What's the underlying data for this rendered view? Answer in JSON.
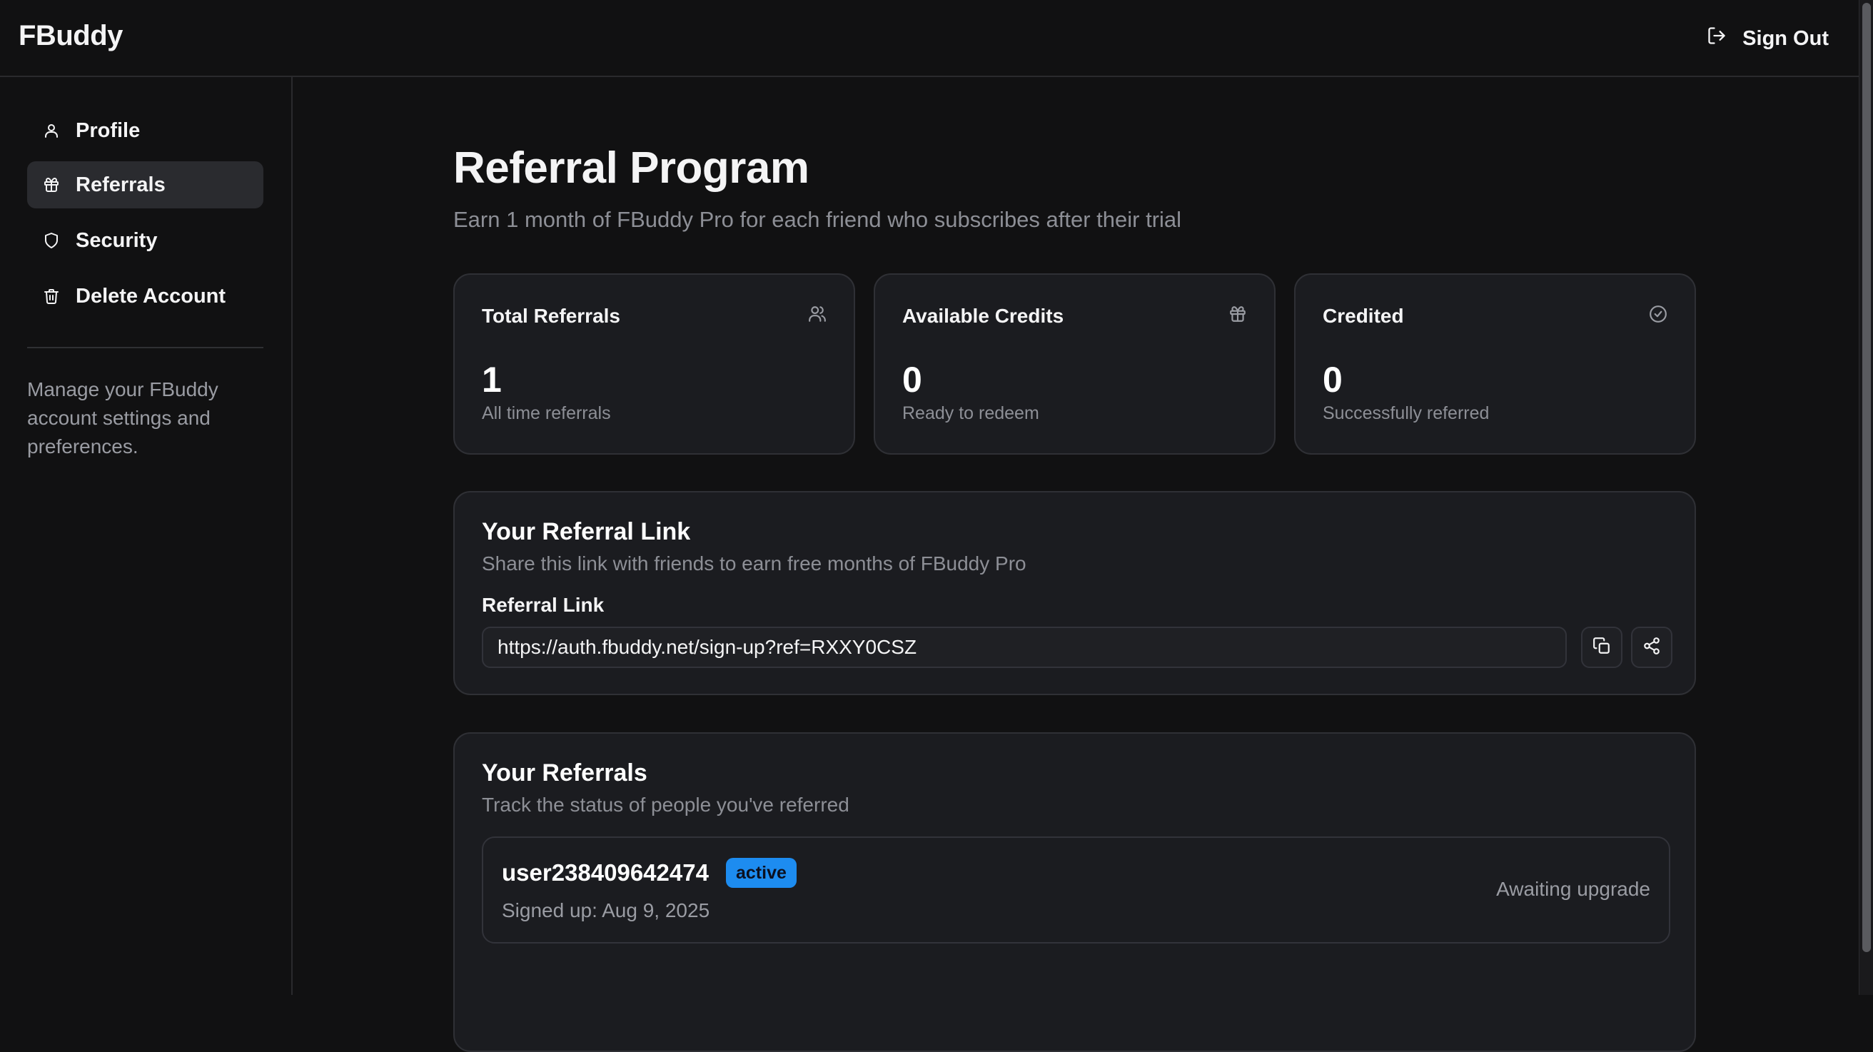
{
  "app": {
    "name": "FBuddy"
  },
  "header": {
    "sign_out_label": "Sign Out"
  },
  "sidebar": {
    "items": [
      {
        "label": "Profile",
        "icon": "user-icon",
        "active": false
      },
      {
        "label": "Referrals",
        "icon": "gift-icon",
        "active": true
      },
      {
        "label": "Security",
        "icon": "shield-icon",
        "active": false
      },
      {
        "label": "Delete Account",
        "icon": "trash-icon",
        "active": false
      }
    ],
    "note": "Manage your FBuddy account settings and preferences."
  },
  "page": {
    "title": "Referral Program",
    "subtitle": "Earn 1 month of FBuddy Pro for each friend who subscribes after their trial"
  },
  "stats": [
    {
      "label": "Total Referrals",
      "value": "1",
      "hint": "All time referrals",
      "icon": "users-icon"
    },
    {
      "label": "Available Credits",
      "value": "0",
      "hint": "Ready to redeem",
      "icon": "gift-icon"
    },
    {
      "label": "Credited",
      "value": "0",
      "hint": "Successfully referred",
      "icon": "check-circle-icon"
    }
  ],
  "referral_link": {
    "title": "Your Referral Link",
    "subtitle": "Share this link with friends to earn free months of FBuddy Pro",
    "field_label": "Referral Link",
    "value": "https://auth.fbuddy.net/sign-up?ref=RXXY0CSZ",
    "copy_icon": "copy-icon",
    "share_icon": "share-icon"
  },
  "referrals": {
    "title": "Your Referrals",
    "subtitle": "Track the status of people you've referred",
    "items": [
      {
        "username": "user238409642474",
        "badge": "active",
        "signed_up": "Signed up: Aug 9, 2025",
        "status": "Awaiting upgrade"
      }
    ]
  },
  "colors": {
    "background": "#111112",
    "card": "#1b1c20",
    "border": "#2f3035",
    "muted_text": "#8d8f96",
    "badge_active": "#1d8cf0",
    "active_nav": "#2a2b2f"
  }
}
